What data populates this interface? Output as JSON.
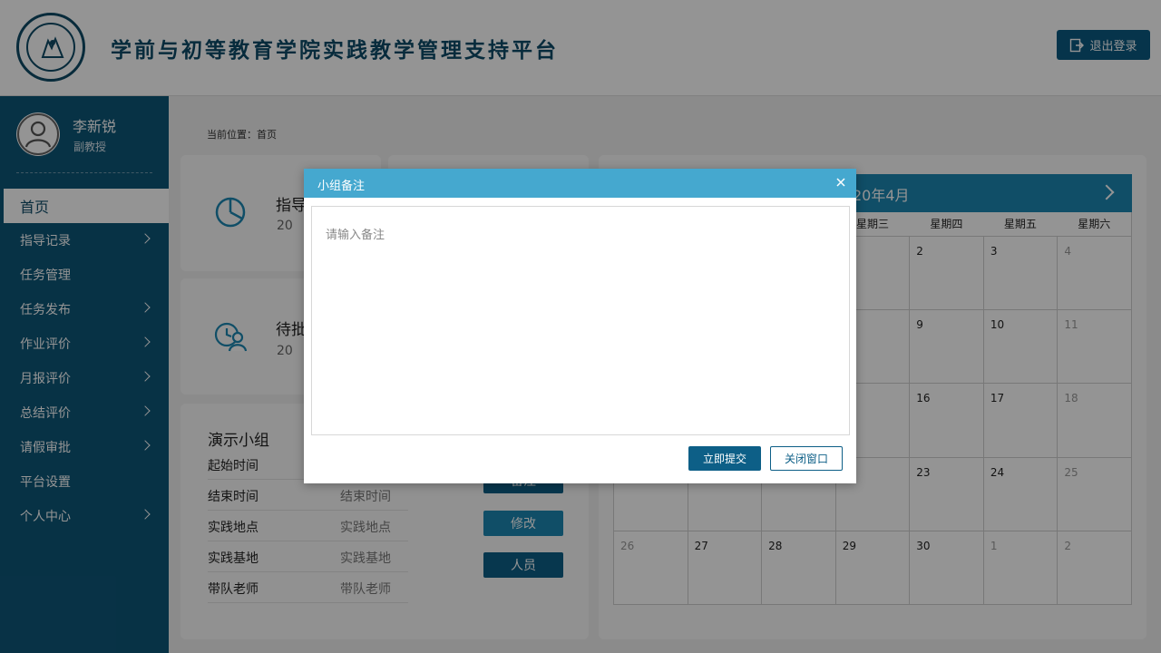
{
  "header": {
    "title": "学前与初等教育学院实践教学管理支持平台",
    "logout_label": "退出登录",
    "logo_icon": "university-seal-icon",
    "logout_icon": "logout-icon"
  },
  "user": {
    "name": "李新锐",
    "role": "副教授",
    "avatar_icon": "user-avatar-icon"
  },
  "sidebar": {
    "items": [
      {
        "label": "首页",
        "active": true,
        "has_submenu": false
      },
      {
        "label": "指导记录",
        "active": false,
        "has_submenu": true
      },
      {
        "label": "任务管理",
        "active": false,
        "has_submenu": false
      },
      {
        "label": "任务发布",
        "active": false,
        "has_submenu": true
      },
      {
        "label": "作业评价",
        "active": false,
        "has_submenu": true
      },
      {
        "label": "月报评价",
        "active": false,
        "has_submenu": true
      },
      {
        "label": "总结评价",
        "active": false,
        "has_submenu": true
      },
      {
        "label": "请假审批",
        "active": false,
        "has_submenu": true
      },
      {
        "label": "平台设置",
        "active": false,
        "has_submenu": false
      },
      {
        "label": "个人中心",
        "active": false,
        "has_submenu": true
      }
    ]
  },
  "breadcrumb": "当前位置：首页",
  "stats": [
    {
      "title": "指导",
      "count": "20",
      "icon": "pie-chart-icon"
    },
    {
      "title": "待批",
      "count": "20",
      "icon": "user-clock-icon"
    }
  ],
  "group": {
    "title": "演示小组",
    "rows": [
      {
        "label": "起始时间",
        "value": ""
      },
      {
        "label": "结束时间",
        "value": "结束时间"
      },
      {
        "label": "实践地点",
        "value": "实践地点"
      },
      {
        "label": "实践基地",
        "value": "实践基地"
      },
      {
        "label": "带队老师",
        "value": "带队老师"
      }
    ],
    "buttons": {
      "note": "备注",
      "edit": "修改",
      "members": "人员"
    }
  },
  "calendar": {
    "month_label": "20年4月",
    "weekdays": [
      "",
      "",
      "",
      "星期三",
      "星期四",
      "星期五",
      "星期六"
    ],
    "weeks": [
      [
        "",
        "",
        "",
        "",
        "2",
        "3",
        "4"
      ],
      [
        "",
        "",
        "",
        "",
        "9",
        "10",
        "11"
      ],
      [
        "",
        "",
        "",
        "",
        "16",
        "17",
        "18"
      ],
      [
        "",
        "",
        "",
        "",
        "23",
        "24",
        "25"
      ],
      [
        "26",
        "27",
        "28",
        "29",
        "30",
        "1",
        "2"
      ]
    ],
    "muted": [
      [
        0,
        6
      ],
      [
        1,
        6
      ],
      [
        2,
        6
      ],
      [
        3,
        6
      ],
      [
        4,
        0
      ],
      [
        4,
        5
      ],
      [
        4,
        6
      ]
    ]
  },
  "modal": {
    "title": "小组备注",
    "textarea_placeholder": "请输入备注",
    "textarea_value": "",
    "submit_label": "立即提交",
    "close_label": "关闭窗口",
    "close_icon": "close-icon"
  },
  "colors": {
    "primary": "#0d5678",
    "header_title": "#0d4a68",
    "modal_header": "#45a8cf",
    "calendar_header": "#1c87b2",
    "overlay": "rgba(0,0,0,0.42)"
  }
}
